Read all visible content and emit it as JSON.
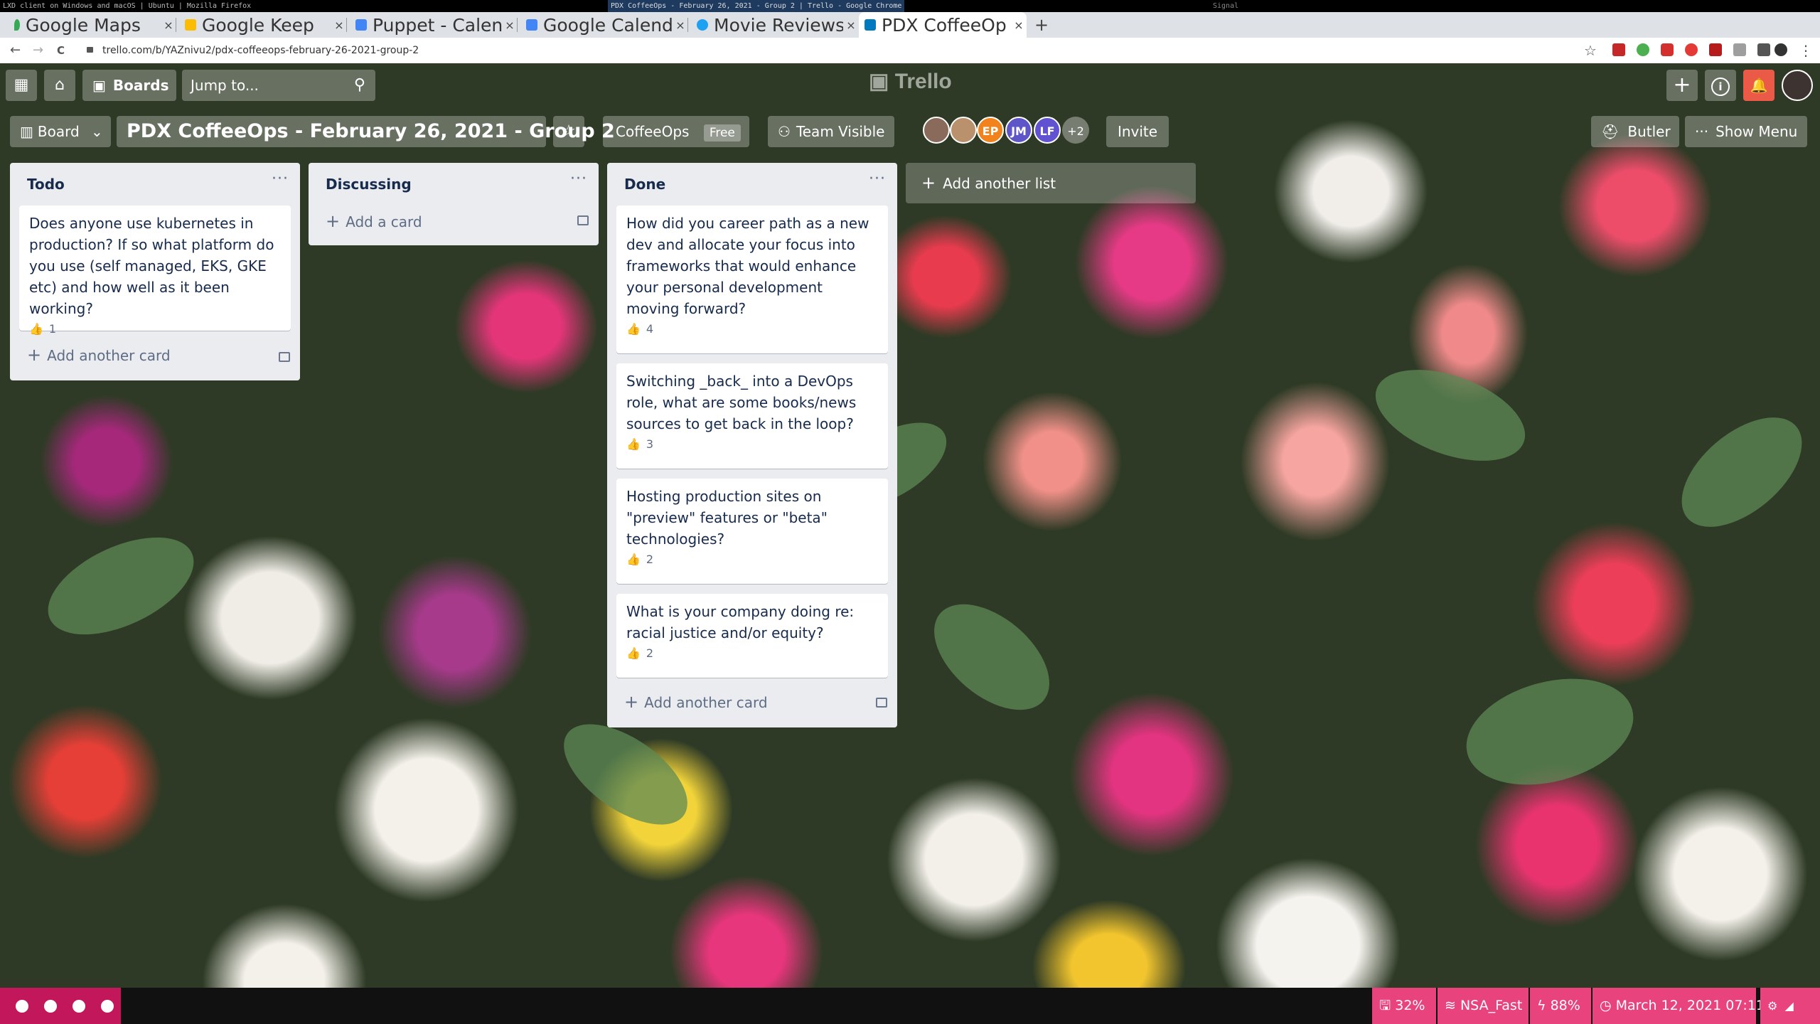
{
  "os_bar": {
    "left_text": "LXD client on Windows and macOS | Ubuntu | Mozilla Firefox",
    "center_text": "PDX CoffeeOps - February 26, 2021 - Group 2 | Trello - Google Chrome",
    "right_text": "Signal"
  },
  "tabs": [
    {
      "title": "Google Maps",
      "color": "#34a853"
    },
    {
      "title": "Google Keep",
      "color": "#fbbc04"
    },
    {
      "title": "Puppet - Calen",
      "color": "#4285f4"
    },
    {
      "title": "Google Calend",
      "color": "#4285f4"
    },
    {
      "title": "Movie Reviews",
      "color": "#1da1f2"
    },
    {
      "title": "PDX CoffeeOp",
      "color": "#0079bf"
    }
  ],
  "newtab_label": "+",
  "close_label": "×",
  "address": {
    "back": "←",
    "forward": "→",
    "reload": "C",
    "url": "trello.com/b/YAZnivu2/pdx-coffeeops-february-26-2021-group-2",
    "star": "☆"
  },
  "trello_header": {
    "apps_icon": "apps-grid-icon",
    "home_icon": "home-icon",
    "boards_label": "Boards",
    "jump_placeholder": "Jump to...",
    "logo": "Trello",
    "create": "+",
    "info": "i",
    "notifications": "bell-icon"
  },
  "board_header": {
    "view_label": "Board",
    "title": "PDX CoffeeOps - February 26, 2021 - Group 2",
    "team_name": "CoffeeOps",
    "team_plan": "Free",
    "visibility": "Team Visible",
    "members": [
      {
        "initials": "",
        "color": "#8a6a5a"
      },
      {
        "initials": "",
        "color": "#b9926d"
      },
      {
        "initials": "EP",
        "color": "#f2821c"
      },
      {
        "initials": "JM",
        "color": "#5e55c8"
      },
      {
        "initials": "LF",
        "color": "#6152d1"
      }
    ],
    "members_more": "+2",
    "invite": "Invite",
    "butler": "Butler",
    "show_menu": "Show Menu"
  },
  "lists": [
    {
      "title": "Todo",
      "menu": "···",
      "cards": [
        {
          "text": "Does anyone use kubernetes in production? If so what platform do you use (self managed, EKS, GKE etc) and how well as it been working?",
          "votes": "1"
        }
      ],
      "add_label": "Add another card"
    },
    {
      "title": "Discussing",
      "menu": "···",
      "cards": [],
      "add_label": "Add a card"
    },
    {
      "title": "Done",
      "menu": "···",
      "cards": [
        {
          "text": "How did you career path as a new dev and allocate your focus into frameworks that would enhance your personal development moving forward?",
          "votes": "4"
        },
        {
          "text": "Switching _back_ into a DevOps role, what are some books/news sources to get back in the loop?",
          "votes": "3"
        },
        {
          "text": "Hosting production sites on \"preview\" features or \"beta\" technologies?",
          "votes": "2"
        },
        {
          "text": "What is your company doing re: racial justice and/or equity?",
          "votes": "2"
        }
      ],
      "add_label": "Add another card"
    }
  ],
  "add_list_label": "Add another list",
  "status_bar": {
    "disk": "32%",
    "wifi": "NSA_Fast",
    "battery": "88%",
    "datetime": "March 12, 2021 07:11"
  },
  "colors": {
    "trello_blue": "#0079bf",
    "list_bg": "#ebecf0",
    "status_pink": "#e8437c"
  }
}
